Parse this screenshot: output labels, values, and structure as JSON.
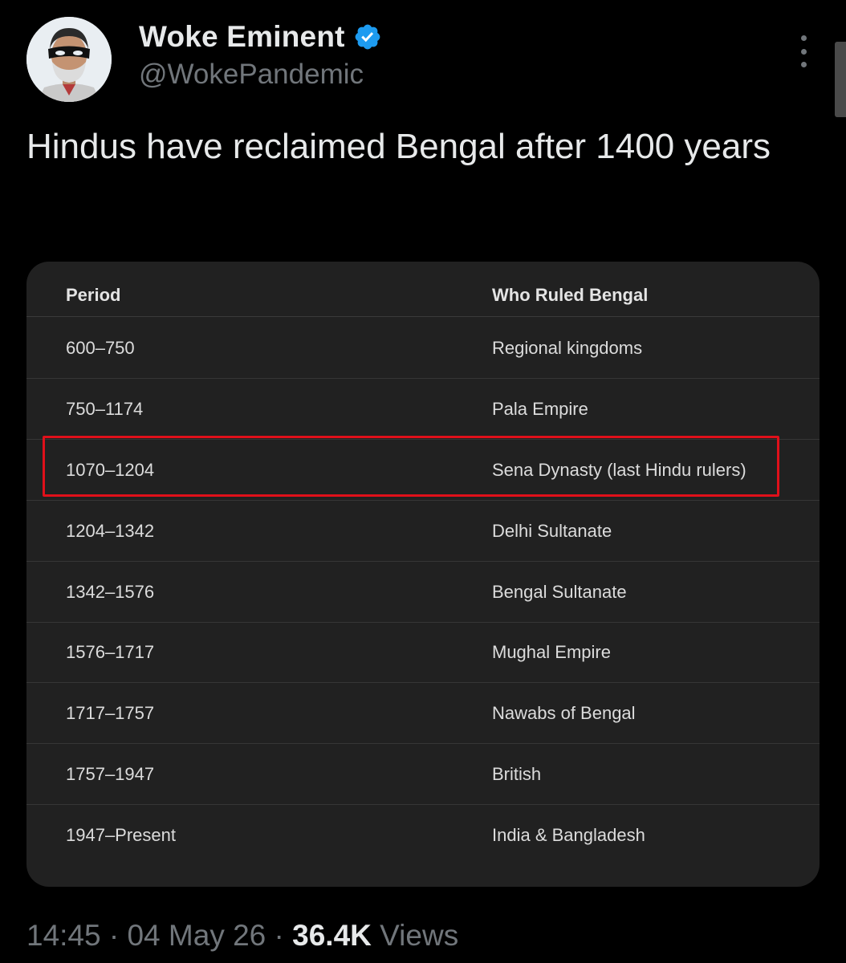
{
  "author": {
    "display_name": "Woke Eminent",
    "handle": "@WokePandemic",
    "verified": true,
    "avatar_icon": "masked-man-avatar"
  },
  "tweet": {
    "text": "Hindus have reclaimed Bengal after 1400 years"
  },
  "table": {
    "headers": {
      "period": "Period",
      "ruler": "Who Ruled Bengal"
    },
    "rows": [
      {
        "period": "600–750",
        "ruler": "Regional kingdoms"
      },
      {
        "period": "750–1174",
        "ruler": "Pala Empire"
      },
      {
        "period": "1070–1204",
        "ruler": "Sena Dynasty (last Hindu rulers)",
        "highlighted": true
      },
      {
        "period": "1204–1342",
        "ruler": "Delhi Sultanate"
      },
      {
        "period": "1342–1576",
        "ruler": "Bengal Sultanate"
      },
      {
        "period": "1576–1717",
        "ruler": "Mughal Empire"
      },
      {
        "period": "1717–1757",
        "ruler": "Nawabs of Bengal"
      },
      {
        "period": "1757–1947",
        "ruler": "British"
      },
      {
        "period": "1947–Present",
        "ruler": "India & Bangladesh"
      }
    ],
    "highlight_color": "#e0101a"
  },
  "meta": {
    "time": "14:45",
    "separator": "·",
    "date": "04 May 26",
    "views_count": "36.4K",
    "views_label": "Views"
  },
  "colors": {
    "background": "#000000",
    "text_primary": "#e7e9ea",
    "text_secondary": "#71767b",
    "verified_blue": "#1d9bf0",
    "card_background": "#212121"
  }
}
